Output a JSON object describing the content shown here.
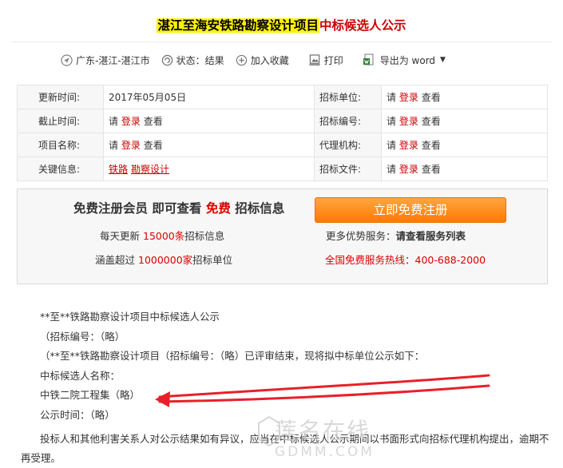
{
  "title": {
    "highlighted": "湛江至海安铁路勘察设计项目",
    "rest": "中标候选人公示"
  },
  "toolbar": {
    "location": "广东-湛江-湛江市",
    "status": "状态：结果",
    "favorite": "加入收藏",
    "print": "打印",
    "export": "导出为 word"
  },
  "info": {
    "rows": [
      {
        "l1": "更新时间:",
        "v1": "2017年05月05日",
        "l2": "招标单位:"
      },
      {
        "l1": "截止时间:",
        "l2": "招标编号:"
      },
      {
        "l1": "项目名称:",
        "l2": "代理机构:"
      },
      {
        "l1": "关键信息:",
        "l2": "招标文件:"
      }
    ],
    "please": "请",
    "login": "登录",
    "view": "查看",
    "keywords": [
      "铁路",
      "勘察设计"
    ]
  },
  "register": {
    "head_a": "免费注册会员  即可查看",
    "head_free": "免费",
    "head_b": "招标信息",
    "button": "立即免费注册",
    "l1a": "每天更新",
    "l1n": "15000条",
    "l1b": "招标信息",
    "l2a": "涵盖超过",
    "l2n": "1000000家",
    "l2b": "招标单位",
    "r1a": "更多优势服务：",
    "r1b": "请查看服务列表",
    "r2": "全国免费服务热线：400-688-2000"
  },
  "content": [
    "**至**铁路勘察设计项目中标候选人公示",
    "（招标编号：（略）",
    "（**至**铁路勘察设计项目（招标编号：（略）已评审结束，现将拟中标单位公示如下：",
    "中标候选人名称：",
    "中铁二院工程集（略）",
    "公示时间：（略）",
    "投标人和其他利害关系人对公示结果如有异议，应当在中标候选人公示期间以书面形式向招标代理机构提出，逾期不再受理。"
  ],
  "watermark": {
    "line1": "莲名在线",
    "line2": "GDMM.COM"
  },
  "colors": {
    "accent_red": "#cc0000",
    "highlight": "#fff200",
    "button_orange": "#ff8a10",
    "arrow_red": "#e8202a"
  }
}
